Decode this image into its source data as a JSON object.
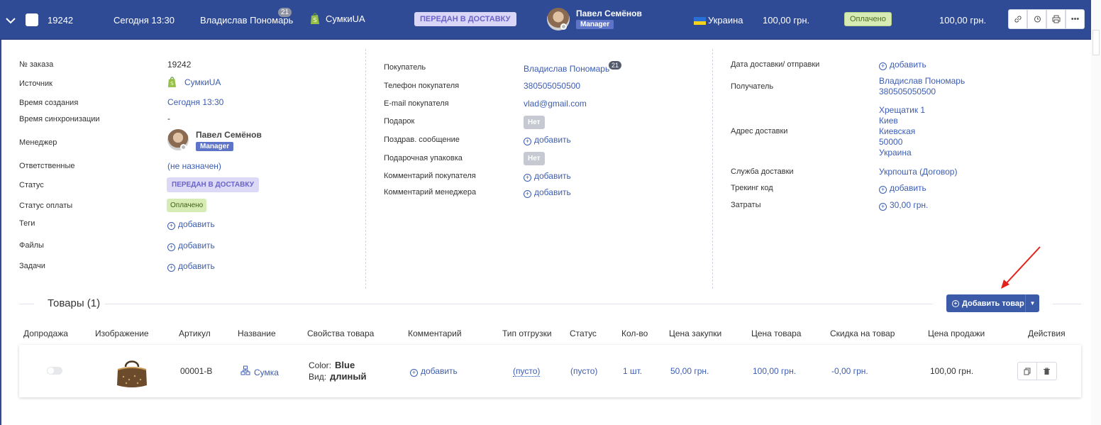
{
  "header": {
    "order_id": "19242",
    "created": "Сегодня 13:30",
    "customer": "Владислав Пономарь",
    "customer_count": "21",
    "shop": "СумкиUA",
    "status": "ПЕРЕДАН В ДОСТАВКУ",
    "manager_name": "Павел Семёнов",
    "manager_role": "Manager",
    "country": "Украина",
    "sum": "100,00 грн.",
    "payment": "Оплачено",
    "total": "100,00 грн.",
    "more": "•••"
  },
  "col1": {
    "order_no_label": "№ заказа",
    "order_no": "19242",
    "source_label": "Источник",
    "source": "СумкиUA",
    "created_label": "Время создания",
    "created": "Сегодня 13:30",
    "sync_label": "Время синхронизации",
    "sync": "-",
    "manager_label": "Менеджер",
    "manager_name": "Павел Семёнов",
    "manager_role": "Manager",
    "responsible_label": "Ответственные",
    "responsible": "(не назначен)",
    "status_label": "Статус",
    "status": "ПЕРЕДАН В ДОСТАВКУ",
    "pay_status_label": "Статус оплаты",
    "pay_status": "Оплачено",
    "tags_label": "Теги",
    "files_label": "Файлы",
    "tasks_label": "Задачи",
    "add": "добавить"
  },
  "col2": {
    "buyer_label": "Покупатель",
    "buyer": "Владислав Пономарь",
    "buyer_count": "21",
    "phone_label": "Телефон покупателя",
    "phone": "380505050500",
    "email_label": "E-mail покупателя",
    "email": "vlad@gmail.com",
    "gift_label": "Подарок",
    "gift": "Нет",
    "greeting_label": "Поздрав. сообщение",
    "wrap_label": "Подарочная упаковка",
    "wrap": "Нет",
    "buyer_comment_label": "Комментарий покупателя",
    "manager_comment_label": "Комментарий менеджера",
    "add": "добавить"
  },
  "col3": {
    "delivery_date_label": "Дата доставки/ отправки",
    "recipient_label": "Получатель",
    "recipient_name": "Владислав Пономарь",
    "recipient_phone": "380505050500",
    "address_label": "Адрес доставки",
    "address_lines": [
      "Хрещатик 1",
      "Киев",
      "Киевская",
      "50000",
      "Украина"
    ],
    "service_label": "Служба доставки",
    "service": "Укрпошта (Договор)",
    "tracking_label": "Трекинг код",
    "costs_label": "Затраты",
    "costs": "30,00 грн.",
    "add": "добавить"
  },
  "goods": {
    "title": "Товары (1)",
    "add_button": "Добавить товар",
    "columns": [
      "Допродажа",
      "Изображение",
      "Артикул",
      "Название",
      "Свойства товара",
      "Комментарий",
      "Тип отгрузки",
      "Статус",
      "Кол-во",
      "Цена закупки",
      "Цена товара",
      "Скидка на товар",
      "Цена продажи",
      "Действия"
    ],
    "row": {
      "sku": "00001-B",
      "name": "Сумка",
      "prop1_key": "Color:",
      "prop1_val": "Blue",
      "prop2_key": "Вид:",
      "prop2_val": "длиный",
      "comment": "добавить",
      "ship_type": "(пусто)",
      "status": "(пусто)",
      "qty": "1 шт.",
      "purchase_price": "50,00 грн.",
      "price": "100,00 грн.",
      "discount": "-0,00 грн.",
      "sale_price": "100,00 грн."
    }
  },
  "colors": {
    "header_bg": "#2f4b95",
    "link": "#3c5db2",
    "status": "#dcd9f7",
    "paid": "#d6ecb4",
    "arrow": "#e3221b"
  }
}
